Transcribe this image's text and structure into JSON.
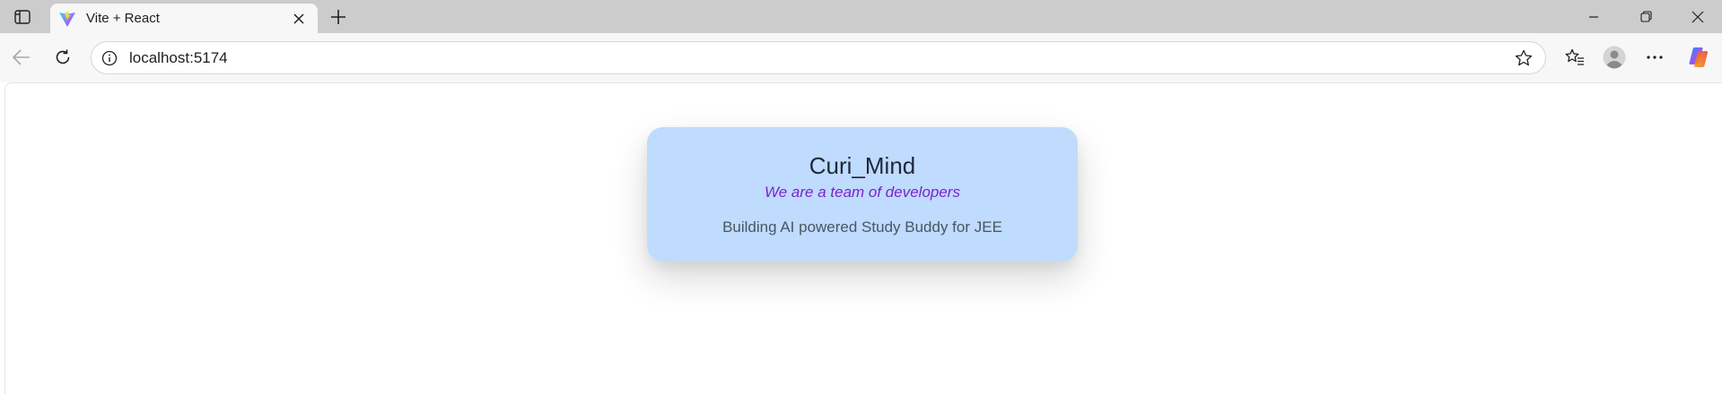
{
  "browser": {
    "tab": {
      "title": "Vite + React",
      "favicon": "vite-logo-icon"
    },
    "address_bar": {
      "url": "localhost:5174"
    },
    "icons": {
      "tab_actions": "tab-actions-icon",
      "tab_close": "close-icon",
      "new_tab": "plus-icon",
      "minimize": "minimize-icon",
      "restore": "restore-icon",
      "close_window": "close-icon",
      "back": "arrow-left-icon",
      "reload": "reload-icon",
      "site_info": "info-icon",
      "add_favorite": "star-icon",
      "favorites": "favorites-icon",
      "profile": "avatar",
      "menu": "more-icon",
      "copilot": "copilot-icon"
    }
  },
  "page": {
    "card": {
      "title": "Curi_Mind",
      "tagline": "We are a team of developers",
      "description": "Building AI powered Study Buddy for JEE"
    },
    "colors": {
      "card_background": "#bfdbfe",
      "title": "#1e293b",
      "tagline": "#7e22ce",
      "description": "#4b5563"
    }
  }
}
